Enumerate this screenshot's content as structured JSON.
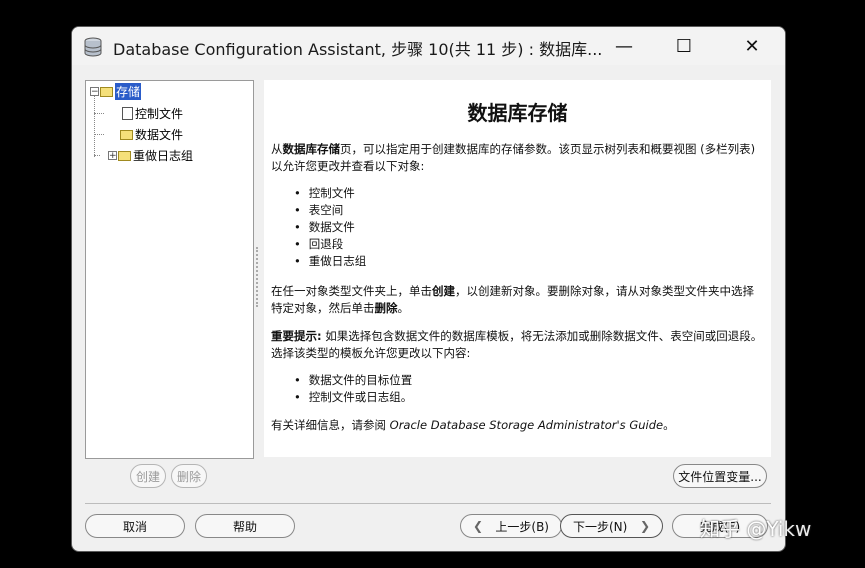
{
  "window": {
    "title": "Database Configuration Assistant, 步骤 10(共 11 步) : 数据库...",
    "minimize_glyph": "—",
    "maximize_glyph": "☐",
    "close_glyph": "✕"
  },
  "tree": {
    "root": {
      "label": "存储",
      "expander": "−"
    },
    "children": [
      {
        "label": "控制文件",
        "icon": "document-icon"
      },
      {
        "label": "数据文件",
        "icon": "folder-icon"
      },
      {
        "label": "重做日志组",
        "icon": "folder-icon",
        "expander": "+"
      }
    ]
  },
  "content": {
    "heading": "数据库存储",
    "intro_prefix": "从",
    "intro_bold": "数据库存储",
    "intro_rest": "页，可以指定用于创建数据库的存储参数。该页显示树列表和概要视图 (多栏列表) 以允许您更改并查看以下对象:",
    "objects": [
      "控制文件",
      "表空间",
      "数据文件",
      "回退段",
      "重做日志组"
    ],
    "create_delete_1": "在任一对象类型文件夹上，单击",
    "create_bold": "创建",
    "create_delete_2": "，以创建新对象。要删除对象，请从对象类型文件夹中选择特定对象，然后单击",
    "delete_bold": "删除",
    "create_delete_3": "。",
    "important_bold": "重要提示:",
    "important_rest": " 如果选择包含数据文件的数据库模板，将无法添加或删除数据文件、表空间或回退段。选择该类型的模板允许您更改以下内容:",
    "changeable": [
      "数据文件的目标位置",
      "控制文件或日志组。"
    ],
    "more_info_prefix": "有关详细信息，请参阅 ",
    "more_info_italic": "Oracle Database Storage Administrator's Guide",
    "more_info_suffix": "。"
  },
  "buttons": {
    "create": "创建",
    "delete": "删除",
    "file_location_vars": "文件位置变量...",
    "cancel": "取消",
    "help": "帮助",
    "back": "上一步(B)",
    "next": "下一步(N)",
    "finish": "完成(F)",
    "back_arrow": "❮",
    "next_arrow": "❯"
  },
  "watermark": "知乎 @Yikw"
}
